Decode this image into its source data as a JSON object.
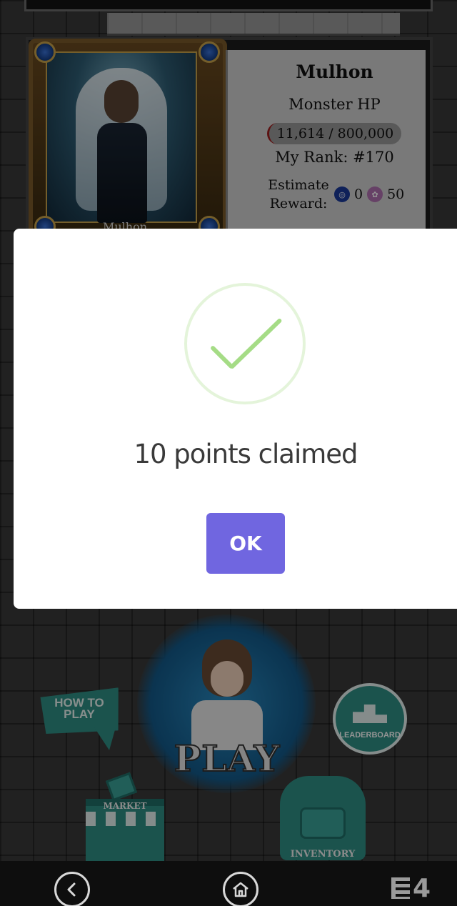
{
  "boss": {
    "name": "Mulhon",
    "card_name": "Mulhon",
    "hp_label": "Monster HP",
    "hp_value": "11,614 / 800,000",
    "rank": "My Rank: #170",
    "reward_label": "Estimate Reward:",
    "reward_steem": "0",
    "reward_token": "50"
  },
  "menu": {
    "how_to_play": "HOW TO PLAY",
    "play": "PLAY",
    "leaderboard": "LEADERBOARD",
    "market": "MARKET",
    "inventory": "INVENTORY"
  },
  "dialog": {
    "title": "10 points claimed",
    "ok_label": "OK"
  },
  "navbar": {
    "logo_text": "4"
  },
  "colors": {
    "confirm_button": "#7066e0",
    "success_green": "#a5dc86"
  }
}
